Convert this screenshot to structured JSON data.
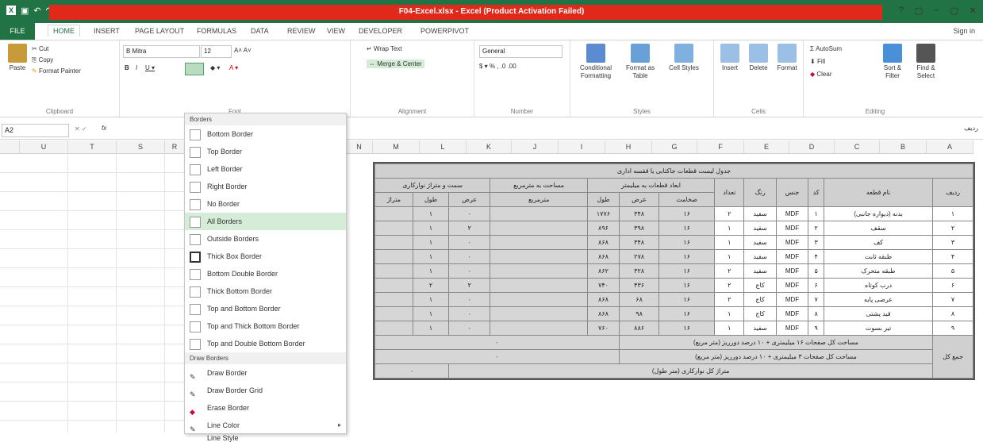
{
  "title": "F04-Excel.xlsx - Excel (Product Activation Failed)",
  "window_controls": [
    "?",
    "▢",
    "–",
    "▢",
    "✕"
  ],
  "qat": [
    "▣",
    "↶",
    "↷",
    "▾"
  ],
  "tabs": [
    "FILE",
    "HOME",
    "INSERT",
    "PAGE LAYOUT",
    "FORMULAS",
    "DATA",
    "REVIEW",
    "VIEW",
    "DEVELOPER",
    "POWERPIVOT"
  ],
  "signin": "Sign in",
  "clipboard": {
    "cut": "Cut",
    "copy": "Copy",
    "paste": "Paste",
    "painter": "Format Painter",
    "label": "Clipboard"
  },
  "font": {
    "name": "B Mitra",
    "size": "12",
    "label": "Font"
  },
  "alignment": {
    "wrap": "Wrap Text",
    "merge": "Merge & Center",
    "label": "Alignment"
  },
  "number": {
    "format": "General",
    "label": "Number"
  },
  "styles": {
    "cond": "Conditional Formatting",
    "table": "Format as Table",
    "cell": "Cell Styles",
    "label": "Styles"
  },
  "cells": {
    "insert": "Insert",
    "delete": "Delete",
    "format": "Format",
    "label": "Cells"
  },
  "editing": {
    "autosum": "AutoSum",
    "fill": "Fill",
    "clear": "Clear",
    "sort": "Sort & Filter",
    "find": "Find & Select",
    "label": "Editing"
  },
  "namebox": "A2",
  "fx": "fx",
  "right_label": "ردیف",
  "columns": [
    "U",
    "T",
    "S",
    "R",
    "N",
    "M",
    "L",
    "K",
    "J",
    "I",
    "H",
    "G",
    "F",
    "E",
    "D",
    "C",
    "B",
    "A"
  ],
  "menu": {
    "section1": "Borders",
    "items": [
      "Bottom Border",
      "Top Border",
      "Left Border",
      "Right Border",
      "No Border",
      "All Borders",
      "Outside Borders",
      "Thick Box Border",
      "Bottom Double Border",
      "Thick Bottom Border",
      "Top and Bottom Border",
      "Top and Thick Bottom Border",
      "Top and Double Bottom Border"
    ],
    "section2": "Draw Borders",
    "draw_items": [
      "Draw Border",
      "Draw Border Grid",
      "Erase Border",
      "Line Color",
      "Line Style"
    ]
  },
  "sheet": {
    "title": "جدول لیست قطعات جاکتابی یا قفسه اداری",
    "headers": {
      "row": "ردیف",
      "part": "نام قطعه",
      "code": "کد",
      "material": "جنس",
      "color": "رنگ",
      "count": "تعداد",
      "dims": "ابعاد قطعات به میلیمتر",
      "thick": "ضخامت",
      "width": "عرض",
      "length": "طول",
      "area": "مساحت به مترمربع",
      "area_unit": "مترمربع",
      "edge": "سمت و متراژ نوارکاری",
      "edge_w": "عرض",
      "edge_l": "طول",
      "edge_m": "متراژ"
    },
    "rows": [
      [
        "۱",
        "بدنه (دیواره جانبی)",
        "۱",
        "MDF",
        "سفید",
        "۲",
        "۱۶",
        "۳۴۸",
        "۱۷۷۶",
        "",
        "۰",
        "۱",
        ""
      ],
      [
        "۲",
        "سقف",
        "۲",
        "MDF",
        "سفید",
        "۱",
        "۱۶",
        "۳۹۸",
        "۸۹۶",
        "",
        "۲",
        "۱",
        ""
      ],
      [
        "۳",
        "کف",
        "۳",
        "MDF",
        "سفید",
        "۱",
        "۱۶",
        "۳۴۸",
        "۸۶۸",
        "",
        "۰",
        "۱",
        ""
      ],
      [
        "۴",
        "طبقه ثابت",
        "۴",
        "MDF",
        "سفید",
        "۱",
        "۱۶",
        "۲۷۸",
        "۸۶۸",
        "",
        "۰",
        "۱",
        ""
      ],
      [
        "۵",
        "طبقه متحرک",
        "۵",
        "MDF",
        "سفید",
        "۲",
        "۱۶",
        "۳۲۸",
        "۸۶۲",
        "",
        "۰",
        "۱",
        ""
      ],
      [
        "۶",
        "درب کوتاه",
        "۶",
        "MDF",
        "کاج",
        "۲",
        "۱۶",
        "۴۳۶",
        "۷۴۰",
        "",
        "۲",
        "۲",
        ""
      ],
      [
        "۷",
        "عرضی پایه",
        "۷",
        "MDF",
        "کاج",
        "۲",
        "۱۶",
        "۶۸",
        "۸۶۸",
        "",
        "۰",
        "۱",
        ""
      ],
      [
        "۸",
        "قید پشتی",
        "۸",
        "MDF",
        "کاج",
        "۱",
        "۱۶",
        "۹۸",
        "۸۶۸",
        "",
        "۰",
        "۱",
        ""
      ],
      [
        "۹",
        "تیر بسوت",
        "۹",
        "MDF",
        "سفید",
        "۱",
        "۱۶",
        "۸۸۶",
        "۷۶۰",
        "",
        "۰",
        "۱",
        ""
      ]
    ],
    "total_label": "جمع کل",
    "summary": [
      {
        "text": "مساحت کل صفحات ۱۶ میلیمتری + ۱۰ درصد دورریز (متر مربع)",
        "value": "۰"
      },
      {
        "text": "مساحت کل صفحات ۳ میلیمتری + ۱۰ درصد دورریز (متر مربع)",
        "value": "۰"
      },
      {
        "text": "متراژ کل نوارکاری (متر طول)",
        "value": "۰"
      }
    ]
  }
}
